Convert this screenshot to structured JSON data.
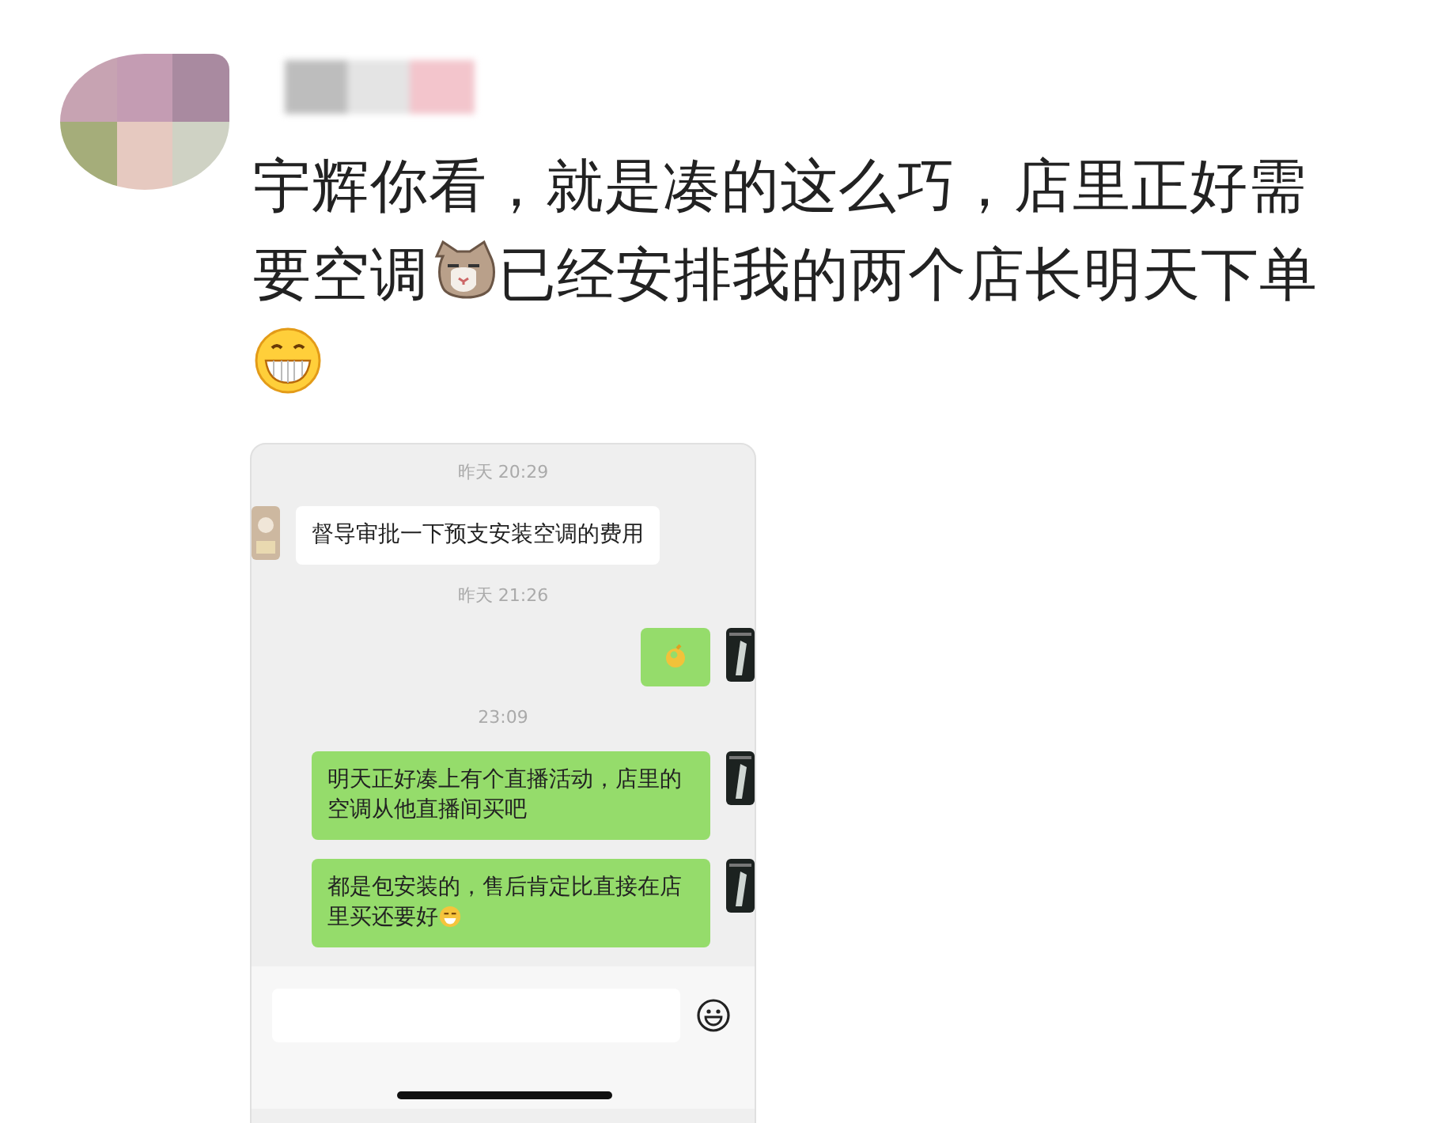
{
  "comment": {
    "lines": [
      [
        {
          "kind": "text",
          "text": "宇辉你看，就是凑的这么巧，店里正好需"
        }
      ],
      [
        {
          "kind": "text",
          "text": "要空调"
        },
        {
          "kind": "cat"
        },
        {
          "kind": "text",
          "text": "已经安排我的两个店长明天下单"
        }
      ],
      [
        {
          "kind": "grin"
        }
      ]
    ]
  },
  "chat": {
    "messages": [
      {
        "kind": "time",
        "text": "昨天 20:29"
      },
      {
        "kind": "incoming",
        "segments": [
          {
            "kind": "text",
            "text": "督导审批一下预支安装空调的费用"
          }
        ]
      },
      {
        "kind": "time",
        "text": "昨天 21:26"
      },
      {
        "kind": "outgoing",
        "segments": [
          {
            "kind": "ok"
          }
        ]
      },
      {
        "kind": "time",
        "text": "23:09"
      },
      {
        "kind": "outgoing",
        "segments": [
          {
            "kind": "text",
            "text": "明天正好凑上有个直播活动，店里的空调从他直播间买吧"
          }
        ]
      },
      {
        "kind": "outgoing",
        "segments": [
          {
            "kind": "text",
            "text": "都是包安装的，售后肯定比直接在店里买还要好"
          },
          {
            "kind": "laugh"
          }
        ]
      }
    ]
  }
}
